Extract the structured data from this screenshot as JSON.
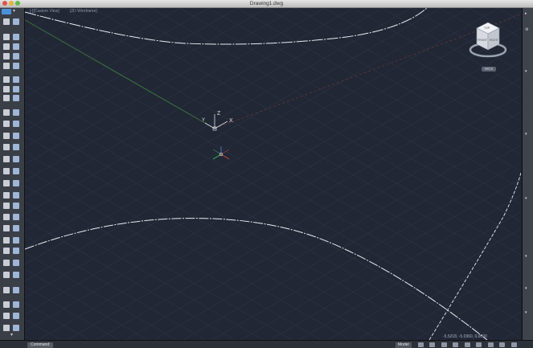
{
  "window": {
    "title": "Drawing1.dwg"
  },
  "viewport": {
    "view_label": "[-][Custom View]",
    "style_label": "[2D Wireframe]",
    "ucs_labels": {
      "x": "X",
      "y": "Y",
      "z": "Z"
    },
    "wcs_label": "WCS",
    "coordinates": "-5.5218, -5.0360, 0.0000",
    "viewcube": {
      "front": "FRONT",
      "right": "RIGHT",
      "top": "TOP"
    }
  },
  "command_line": {
    "label": "Command:"
  },
  "status": {
    "model_tab": "Model"
  },
  "colors": {
    "background": "#212735",
    "grid": "#2d3445",
    "curve": "#e8ecf2",
    "x_axis": "#c0392b",
    "y_axis": "#2ecc71",
    "z_axis": "#3d7bd9"
  }
}
